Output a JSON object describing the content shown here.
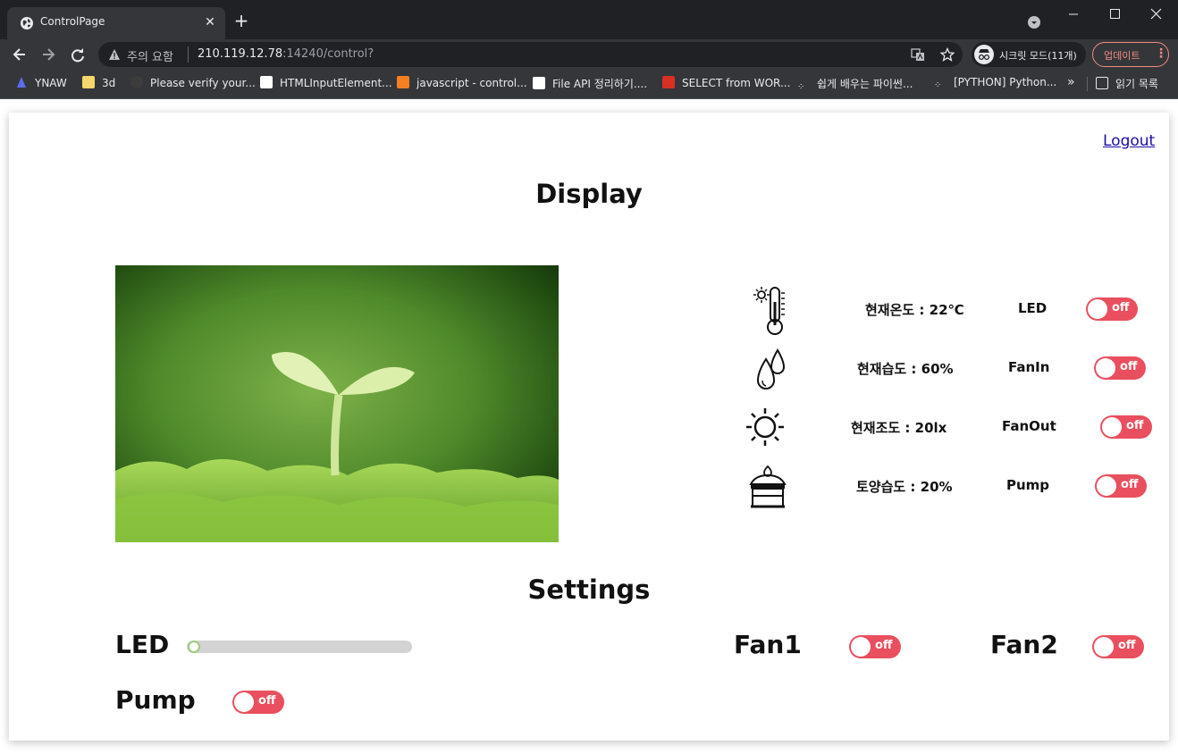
{
  "browser": {
    "tab_title": "ControlPage",
    "security_warning": "주의 요함",
    "url_host": "210.119.12.78",
    "url_rest": ":14240/control?",
    "incognito_label": "시크릿 모드(11개)",
    "update_label": "업데이트",
    "bookmarks": [
      "YNAW",
      "3d",
      "Please verify your...",
      "HTMLInputElement...",
      "javascript - control...",
      "File API 정리하기....",
      "SELECT from WOR...",
      "쉽게 배우는 파이썬...",
      "[PYTHON] Python..."
    ],
    "bookmark_overflow": "»",
    "reading_list": "읽기 목록"
  },
  "page": {
    "logout_label": "Logout",
    "display_title": "Display",
    "settings_title": "Settings",
    "sensors": [
      {
        "icon": "thermometer-icon",
        "value": "현재온도 : 22℃",
        "device": "LED",
        "toggle": "off"
      },
      {
        "icon": "humidity-drops-icon",
        "value": "현재습도 : 60%",
        "device": "FanIn",
        "toggle": "off"
      },
      {
        "icon": "sun-icon",
        "value": "현재조도 : 20lx",
        "device": "FanOut",
        "toggle": "off"
      },
      {
        "icon": "soil-pot-icon",
        "value": "토양습도 : 20%",
        "device": "Pump",
        "toggle": "off"
      }
    ],
    "settings": {
      "led_label": "LED",
      "led_level": 0,
      "fan1_label": "Fan1",
      "fan1_toggle": "off",
      "fan2_label": "Fan2",
      "fan2_toggle": "off",
      "pump_label": "Pump",
      "pump_toggle": "off"
    },
    "toggle_color": "#e94f5e"
  }
}
